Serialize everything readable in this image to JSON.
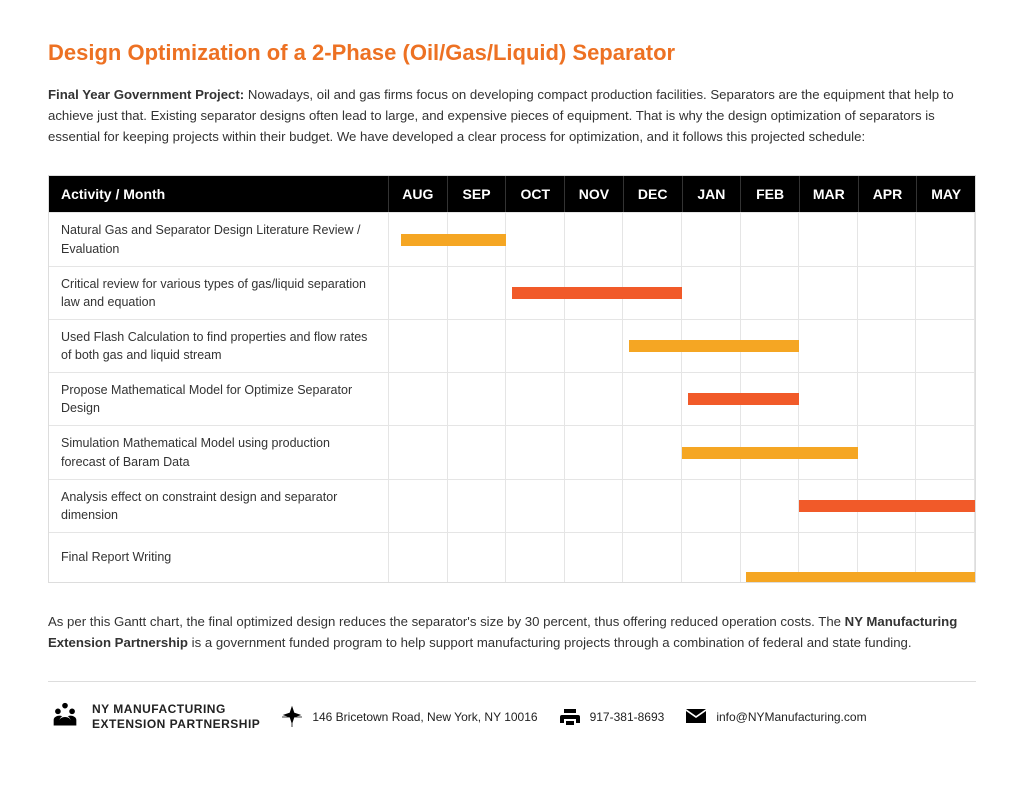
{
  "title": "Design Optimization of a 2-Phase (Oil/Gas/Liquid) Separator",
  "intro": {
    "bold": "Final Year Government Project:",
    "text": " Nowadays, oil and gas firms focus on developing compact production facilities. Separators are the equipment that help to achieve just that. Existing separator designs often lead to large, and expensive pieces of equipment. That is why the design optimization of separators is essential for keeping projects within their budget. We have developed a clear process for optimization, and it follows this projected schedule:"
  },
  "chart_data": {
    "type": "gantt",
    "header_activity": "Activity / Month",
    "months": [
      "AUG",
      "SEP",
      "OCT",
      "NOV",
      "DEC",
      "JAN",
      "FEB",
      "MAR",
      "APR",
      "MAY"
    ],
    "activities": [
      {
        "label": "Natural Gas and Separator Design Literature Review / Evaluation",
        "start": 0.2,
        "end": 2.0,
        "color": "amber",
        "final": false
      },
      {
        "label": "Critical review for various types of gas/liquid separation law and equation",
        "start": 2.1,
        "end": 5.0,
        "color": "orange",
        "final": false
      },
      {
        "label": "Used Flash Calculation to find properties and flow rates of both gas and liquid stream",
        "start": 4.1,
        "end": 7.0,
        "color": "amber",
        "final": false
      },
      {
        "label": "Propose Mathematical Model for Optimize Separator Design",
        "start": 5.1,
        "end": 7.0,
        "color": "orange",
        "final": false
      },
      {
        "label": "Simulation Mathematical Model using production forecast of Baram Data",
        "start": 5.0,
        "end": 8.0,
        "color": "amber",
        "final": false
      },
      {
        "label": "Analysis effect on constraint design and separator dimension",
        "start": 7.0,
        "end": 10.0,
        "color": "orange",
        "final": false
      },
      {
        "label": "Final Report Writing",
        "start": 6.1,
        "end": 10.0,
        "color": "amber",
        "final": true
      }
    ]
  },
  "outro": {
    "pre": "As per this Gantt chart, the final optimized design reduces the separator's size by 30 percent, thus offering reduced operation costs. The ",
    "bold": "NY Manufacturing Extension Partnership",
    "post": " is a government funded program to help support manufacturing projects through a combination of federal and state funding."
  },
  "footer": {
    "org_name_line1": "NY MANUFACTURING",
    "org_name_line2": "EXTENSION PARTNERSHIP",
    "address": "146 Bricetown Road, New York, NY 10016",
    "phone": "917-381-8693",
    "email": "info@NYManufacturing.com"
  }
}
